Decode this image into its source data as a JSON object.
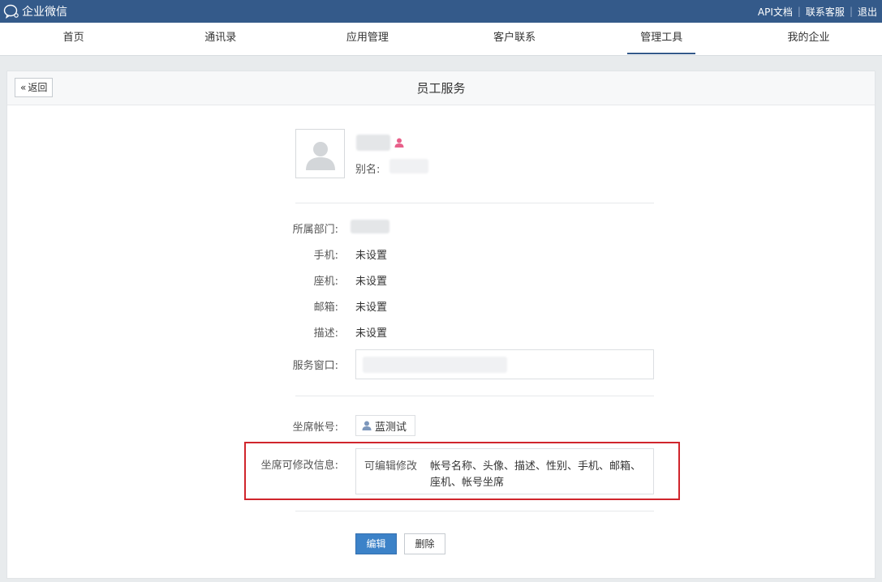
{
  "topbar": {
    "brand": "企业微信",
    "links": [
      "API文档",
      "联系客服",
      "退出"
    ]
  },
  "nav": {
    "items": [
      "首页",
      "通讯录",
      "应用管理",
      "客户联系",
      "管理工具",
      "我的企业"
    ],
    "active_index": 4
  },
  "page": {
    "back_label": "返回",
    "title": "员工服务"
  },
  "profile": {
    "alias_label": "别名:",
    "department_label": "所属部门:",
    "mobile_label": "手机:",
    "mobile_value": "未设置",
    "phone_label": "座机:",
    "phone_value": "未设置",
    "email_label": "邮箱:",
    "email_value": "未设置",
    "desc_label": "描述:",
    "desc_value": "未设置",
    "service_window_label": "服务窗口:"
  },
  "seat": {
    "account_label": "坐席帐号:",
    "account_value": "蓝测试",
    "editable_label": "坐席可修改信息:",
    "editable_prefix": "可编辑修改",
    "editable_line1": "帐号名称、头像、描述、性别、手机、邮箱、",
    "editable_line2": "座机、帐号坐席"
  },
  "actions": {
    "edit_label": "编辑",
    "delete_label": "删除"
  },
  "colors": {
    "header_bg": "#345a8a",
    "primary_button": "#3c82c8",
    "highlight_border": "#d0252c",
    "gender_icon": "#e8608a"
  }
}
